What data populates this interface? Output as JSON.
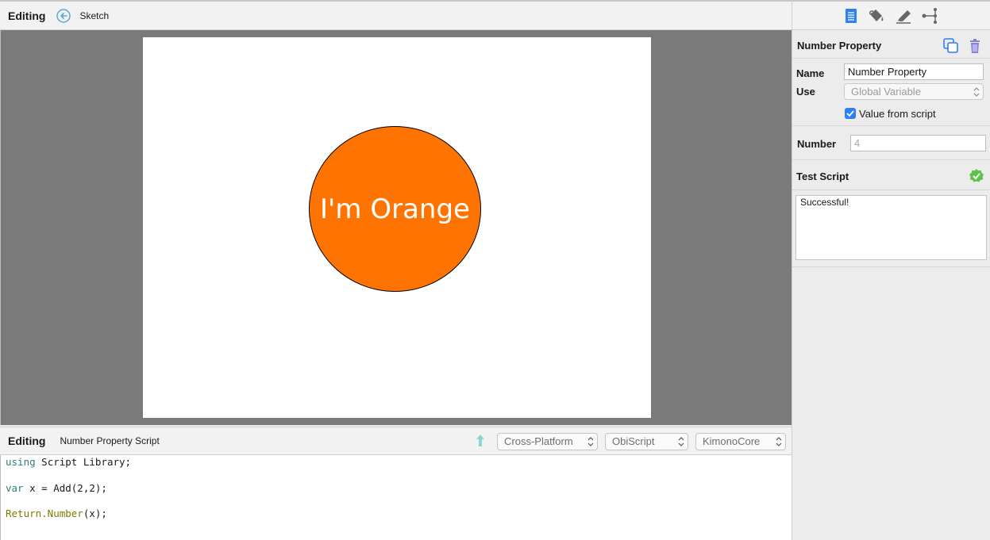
{
  "top_bar": {
    "mode": "Editing",
    "breadcrumb": "Sketch"
  },
  "canvas": {
    "shape_label": "I'm Orange",
    "shape_color": "#ff7400"
  },
  "script_bar": {
    "mode": "Editing",
    "script_name": "Number Property Script",
    "platform_select": "Cross-Platform",
    "language_select": "ObiScript",
    "library_select": "KimonoCore"
  },
  "code": {
    "line1_kw": "using",
    "line1_rest": " Script Library;",
    "line3_kw": "var",
    "line3_rest": " x = Add(2,2);",
    "line5_fn": "Return.Number",
    "line5_rest": "(x);"
  },
  "inspector": {
    "title": "Number Property",
    "name_label": "Name",
    "name_value": "Number Property",
    "use_label": "Use",
    "use_value": "Global Variable",
    "checkbox_label": "Value from script",
    "checkbox_checked": true,
    "number_label": "Number",
    "number_value": "4",
    "test_script_label": "Test Script",
    "test_output": "Successful!"
  },
  "colors": {
    "accent": "#2f7ff5",
    "success": "#5dc24a",
    "canvas_bg": "#7a7a7a"
  },
  "icons": [
    "back-arrow-icon",
    "upload-arrow-icon",
    "document-list-icon",
    "paint-bucket-icon",
    "highlighter-icon",
    "connections-icon",
    "duplicate-icon",
    "trash-icon",
    "success-check-icon"
  ]
}
